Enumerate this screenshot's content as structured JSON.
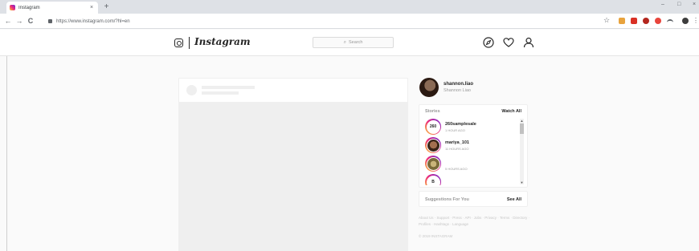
{
  "browser": {
    "tab_title": "Instagram",
    "tab_close": "×",
    "new_tab": "+",
    "window_controls": [
      "–",
      "□",
      "×"
    ],
    "url": "https://www.instagram.com/?hl=en",
    "nav": {
      "back": "←",
      "forward": "→",
      "reload": "C"
    }
  },
  "ig": {
    "logo_text": "Instagram",
    "search_placeholder": "Search",
    "icons": [
      "compass-icon",
      "heart-icon",
      "person-icon"
    ]
  },
  "profile": {
    "username": "shannon.liao",
    "full_name": "Shannon Liao"
  },
  "stories": {
    "title": "Stories",
    "action": "Watch All",
    "items": [
      {
        "user": "260samplesale",
        "time": "1 HOUR AGO",
        "badge": "260"
      },
      {
        "user": "mariya_101",
        "time": "11 HOURS AGO",
        "badge": ""
      },
      {
        "user": "",
        "time": "5 HOURS AGO",
        "badge": ""
      },
      {
        "user": "",
        "time": "",
        "badge": "B"
      }
    ]
  },
  "suggestions": {
    "title": "Suggestions For You",
    "action": "See All"
  },
  "footer": {
    "links": "About Us · Support · Press · API · Jobs · Privacy · Terms · Directory · Profiles · Hashtags · Language",
    "copyright": "© 2019 INSTAGRAM"
  },
  "colors": {
    "story_ring": "#ee2a7b",
    "text_primary": "#262626",
    "text_secondary": "#999999",
    "page_bg": "#fafafa"
  }
}
